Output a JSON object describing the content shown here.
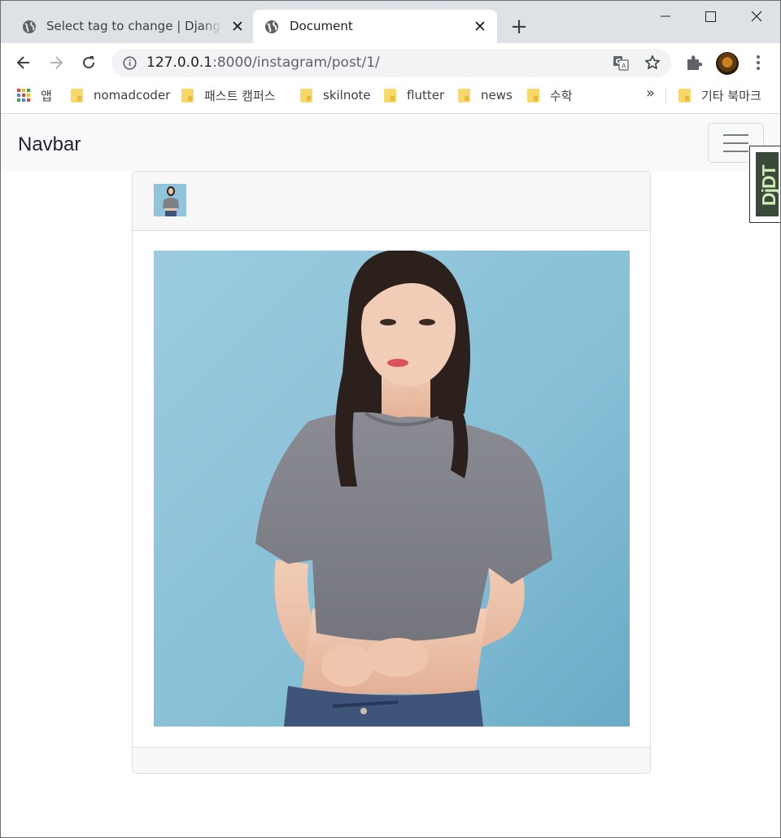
{
  "browser": {
    "tabs": [
      {
        "title": "Select tag to change | Django site admin",
        "active": false
      },
      {
        "title": "Document",
        "active": true
      }
    ],
    "address": {
      "host": "127.0.0.1",
      "rest": ":8000/instagram/post/1/"
    },
    "bookmarks": [
      {
        "label": "앱",
        "type": "apps"
      },
      {
        "label": "nomadcoder",
        "type": "folder"
      },
      {
        "label": "패스트 캠퍼스",
        "type": "folder"
      },
      {
        "label": "skilnote",
        "type": "folder"
      },
      {
        "label": "flutter",
        "type": "folder"
      },
      {
        "label": "news",
        "type": "folder"
      },
      {
        "label": "수학",
        "type": "folder"
      },
      {
        "label": "기타 북마크",
        "type": "folder"
      }
    ],
    "bookmarks_overflow": "»"
  },
  "page": {
    "navbar": {
      "brand": "Navbar"
    },
    "debug_toolbar": {
      "label": "DjDT"
    },
    "post": {
      "image": "woman-in-grey-crop-top-photo",
      "author_avatar": "author-thumbnail"
    }
  },
  "colors": {
    "accent": "#1a73e8",
    "photo_bg": "#8cc3d8",
    "shirt": "#7f8088"
  }
}
